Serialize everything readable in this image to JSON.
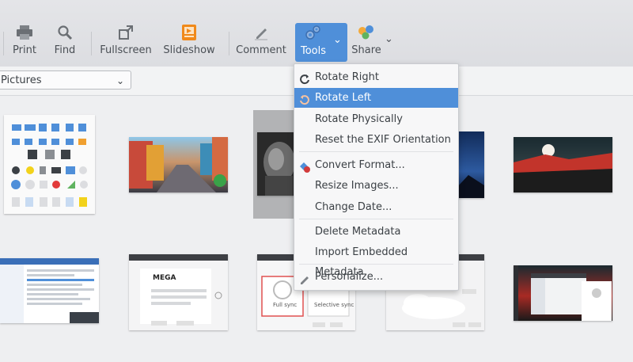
{
  "toolbar": {
    "print": "Print",
    "find": "Find",
    "fullscreen": "Fullscreen",
    "slideshow": "Slideshow",
    "comment": "Comment",
    "tools": "Tools",
    "share": "Share"
  },
  "path": {
    "current": "Pictures"
  },
  "tools_menu": {
    "items": [
      "Rotate Right",
      "Rotate Left",
      "Rotate Physically",
      "Reset the EXIF Orientation",
      "Convert Format...",
      "Resize Images...",
      "Change Date...",
      "Delete Metadata",
      "Import Embedded Metadata",
      "Personalize..."
    ],
    "highlighted": "Rotate Left"
  },
  "thumbnails": {
    "mega_logo": "MEGA",
    "full_sync": "Full sync",
    "selective_sync": "Selective sync"
  },
  "colors": {
    "accent": "#4f8fd9",
    "toolbar_bg": "#dcdde1",
    "gallery_bg": "#eeeff1"
  }
}
